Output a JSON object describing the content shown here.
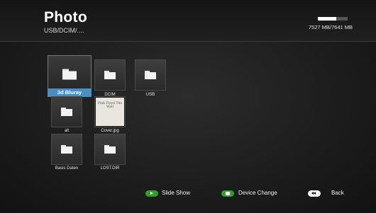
{
  "header": {
    "title": "Photo",
    "path": "USB/DCIM/....",
    "storage": {
      "used_fraction": 0.62,
      "text": "7527 MB/7641 MB"
    }
  },
  "items": [
    {
      "label": "3d Bluray",
      "type": "folder",
      "selected": true
    },
    {
      "label": "DCIM",
      "type": "folder",
      "selected": false
    },
    {
      "label": "USB",
      "type": "folder",
      "selected": false
    },
    {
      "label": "alt",
      "type": "folder",
      "selected": false
    },
    {
      "label": "Cover.jpg",
      "type": "image",
      "selected": false
    },
    {
      "label": "Basis Daten",
      "type": "folder",
      "selected": false
    },
    {
      "label": "LOST.DIR",
      "type": "folder",
      "selected": false
    }
  ],
  "thumbnail_text": "Pink Floyd The Wall",
  "footer": {
    "slideshow_label": "Slide Show",
    "device_change_label": "Device Change",
    "back_label": "Back"
  },
  "colors": {
    "accent": "#4a8fc0",
    "green_button": "#2ea02e"
  }
}
